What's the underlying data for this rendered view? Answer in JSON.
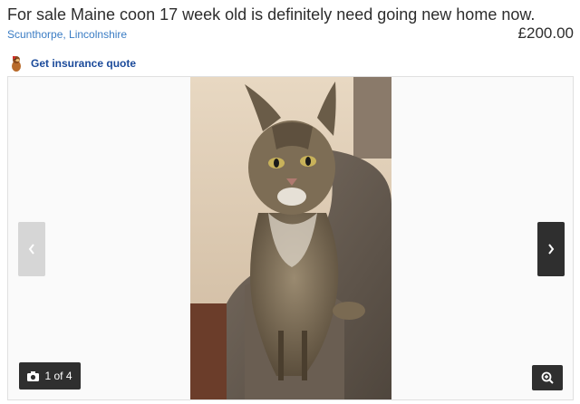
{
  "listing": {
    "title": "For sale Maine coon 17 week old is definitely need going new home now.",
    "price": "£200.00",
    "location": "Scunthorpe, Lincolnshire"
  },
  "insurance": {
    "label": "Get insurance quote",
    "icon": "meerkat-icon"
  },
  "gallery": {
    "counter": "1 of 4",
    "prev_icon": "chevron-left-icon",
    "next_icon": "chevron-right-icon",
    "zoom_icon": "zoom-in-icon",
    "camera_icon": "camera-icon"
  },
  "colors": {
    "link": "#3a7cc4",
    "insurance_link": "#1b4a9a",
    "control_dark": "#2f2f2f",
    "control_disabled": "#d6d6d6"
  }
}
